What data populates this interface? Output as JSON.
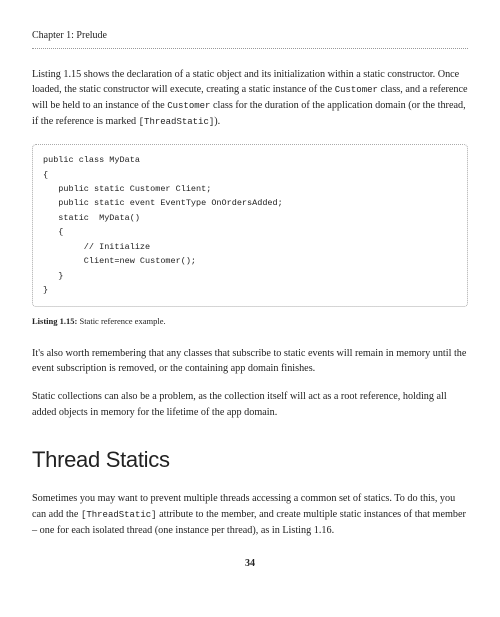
{
  "header": {
    "chapter": "Chapter 1: Prelude"
  },
  "paragraphs": {
    "p1a": "Listing 1.15 shows the declaration of a static object and its initialization within a static constructor. Once loaded, the static constructor will execute, creating a static instance of the ",
    "p1_code1": "Customer",
    "p1b": " class, and a reference will be held to an instance of the ",
    "p1_code2": "Customer",
    "p1c": " class for the duration of the application domain (or the thread, if the reference is marked ",
    "p1_code3": "[ThreadStatic]",
    "p1d": ").",
    "p2": "It's also worth remembering that any classes that subscribe to static events will remain in memory until the event subscription is removed, or the containing app domain finishes.",
    "p3": "Static collections can also be a problem, as the collection itself will act as a root reference, holding all added objects in memory for the lifetime of the app domain.",
    "p4a": "Sometimes you may want to prevent multiple threads accessing a common set of statics. To do this, you can add the ",
    "p4_code1": "[ThreadStatic]",
    "p4b": " attribute to the member, and create multiple static instances of that member – one for each isolated thread (one instance per thread), as in Listing 1.16."
  },
  "code_block": "public class MyData\n{\n   public static Customer Client;\n   public static event EventType OnOrdersAdded;\n   static  MyData()\n   {\n        // Initialize\n        Client=new Customer();\n   }\n}",
  "listing_caption": {
    "label": "Listing 1.15:",
    "text": "  Static reference example."
  },
  "section_heading": "Thread Statics",
  "page_number": "34"
}
